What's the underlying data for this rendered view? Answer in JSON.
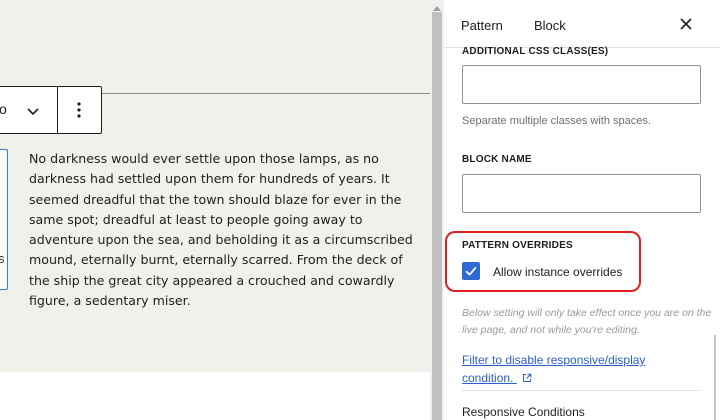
{
  "toolbar": {
    "partial_glyph": "o",
    "chevron_icon": "chevron-down-icon",
    "more_icon": "more-vertical-icon"
  },
  "canvas": {
    "edge_partial_text": "s",
    "paragraph": "No darkness would ever settle upon those lamps, as no darkness had settled upon them for hundreds of years. It seemed dreadful that the town should blaze for ever in the same spot; dreadful at least to people going away to adventure upon the sea, and beholding it as a circumscribed mound, eternally burnt, eternally scarred. From the deck of the ship the great city appeared a crouched and cowardly figure, a sedentary miser."
  },
  "sidebar": {
    "tabs": [
      {
        "label": "Pattern"
      },
      {
        "label": "Block"
      }
    ],
    "close_icon": "close-icon",
    "css_classes_label": "ADDITIONAL CSS CLASS(ES)",
    "css_classes_value": "",
    "css_help": "Separate multiple classes with spaces.",
    "block_name_label": "BLOCK NAME",
    "block_name_value": "",
    "pattern_overrides_label": "PATTERN OVERRIDES",
    "allow_overrides_label": "Allow instance overrides",
    "allow_overrides_checked": true,
    "note": "Below setting will only take effect once you are on the live page, and not while you're editing.",
    "filter_link": "Filter to disable responsive/display condition.",
    "external_icon": "external-link-icon",
    "responsive_title": "Responsive Conditions"
  },
  "colors": {
    "accent": "#2d6bd1",
    "highlight_red": "#e0201c",
    "canvas_bg": "#f2f0ea",
    "link": "#2b5fc9"
  }
}
